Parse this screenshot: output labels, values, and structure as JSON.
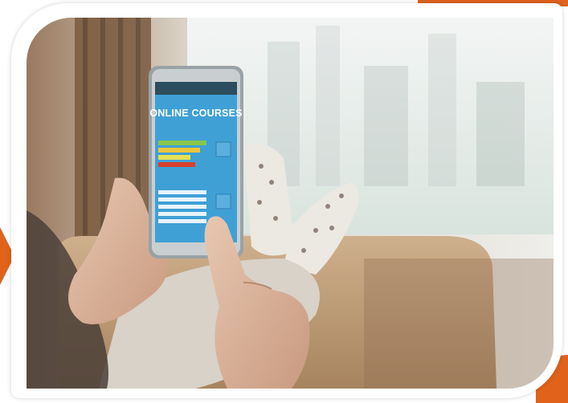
{
  "image": {
    "phone_screen": {
      "title": "ONLINE COURSES"
    },
    "colors": {
      "accent": "#e0621b",
      "screen_blue": "#3fa0d6",
      "bar_green": "#86c74d",
      "bar_yellow": "#f2c63a",
      "bar_red": "#d8402e"
    }
  }
}
